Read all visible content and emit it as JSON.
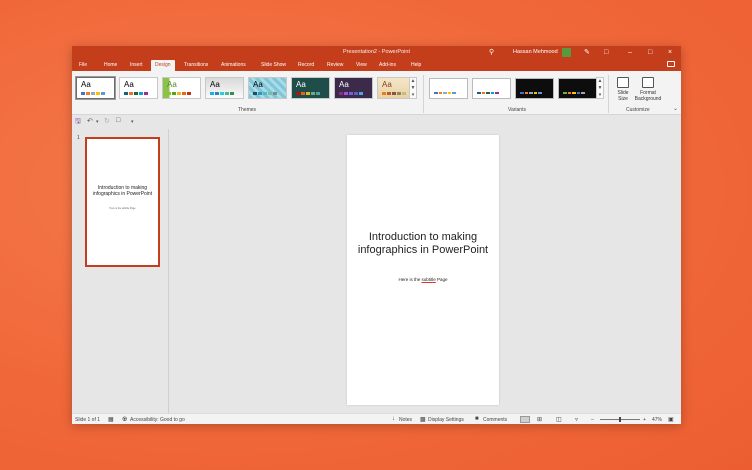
{
  "window": {
    "title": "Presentation2  -  PowerPoint",
    "user_name": "Hassan Mehmood"
  },
  "tabs": [
    "File",
    "Home",
    "Insert",
    "Design",
    "Transitions",
    "Animations",
    "Slide Show",
    "Record",
    "Review",
    "View",
    "Add-ins",
    "Help"
  ],
  "active_tab": "Design",
  "ribbon": {
    "theme_sample": "Aa",
    "themes_label": "Themes",
    "variants_label": "Variants",
    "customize_label": "Customize",
    "slide_size_label": "Slide Size",
    "format_background_label": "Format Background"
  },
  "thumbnails": {
    "slide_number": "1",
    "title": "Introduction to making infographics in PowerPoint",
    "subtitle": "Here is the subtitle Page"
  },
  "slide": {
    "title": "Introduction to making infographics in PowerPoint",
    "subtitle_prefix": "Here is the ",
    "subtitle_underlined": "subtitle",
    "subtitle_suffix": " Page"
  },
  "statusbar": {
    "slide_count": "Slide 1 of 1",
    "accessibility": "Accessibility: Good to go",
    "notes": "Notes",
    "display_settings": "Display Settings",
    "comments": "Comments",
    "zoom": "47%"
  },
  "colors": {
    "accent": "#c43e1c",
    "background": "#f0683a"
  }
}
